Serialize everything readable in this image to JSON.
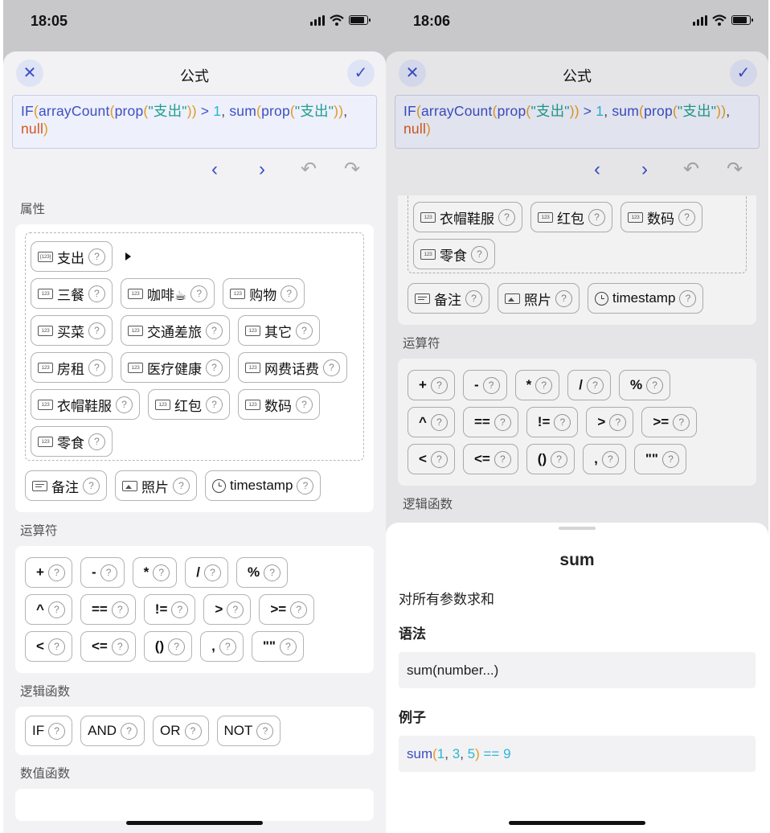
{
  "left": {
    "status_time": "18:05",
    "title": "公式",
    "formula": [
      {
        "t": "IF",
        "c": "k"
      },
      {
        "t": "(",
        "c": "p"
      },
      {
        "t": "arrayCount",
        "c": "k"
      },
      {
        "t": "(",
        "c": "p"
      },
      {
        "t": "prop",
        "c": "k"
      },
      {
        "t": "(",
        "c": "p"
      },
      {
        "t": "\"支出\"",
        "c": "s"
      },
      {
        "t": ")",
        "c": "p"
      },
      {
        "t": ")",
        "c": "p"
      },
      {
        "t": " > ",
        "c": "k"
      },
      {
        "t": "1",
        "c": "num"
      },
      {
        "t": ", ",
        "c": "g"
      },
      {
        "t": "sum",
        "c": "k"
      },
      {
        "t": "(",
        "c": "p"
      },
      {
        "t": "prop",
        "c": "k"
      },
      {
        "t": "(",
        "c": "p"
      },
      {
        "t": "\"支出\"",
        "c": "s"
      },
      {
        "t": ")",
        "c": "p"
      },
      {
        "t": ")",
        "c": "p"
      },
      {
        "t": ", ",
        "c": "g"
      },
      {
        "t": "null",
        "c": "n"
      },
      {
        "t": ")",
        "c": "p"
      }
    ],
    "sections": {
      "properties": "属性",
      "operators": "运算符",
      "logic": "逻辑函数",
      "numeric": "数值函数"
    },
    "property_group": {
      "parent": "支出",
      "children": [
        [
          "三餐",
          "咖啡☕",
          "购物"
        ],
        [
          "买菜",
          "交通差旅",
          "其它"
        ],
        [
          "房租",
          "医疗健康",
          "网费话费"
        ],
        [
          "衣帽鞋服",
          "红包",
          "数码"
        ],
        [
          "零食"
        ]
      ]
    },
    "other_props": [
      {
        "label": "备注",
        "icon": "note"
      },
      {
        "label": "照片",
        "icon": "photo"
      },
      {
        "label": "timestamp",
        "icon": "clock"
      }
    ],
    "operators": [
      [
        "+",
        "-",
        "*",
        "/",
        "%"
      ],
      [
        "^",
        "==",
        "!=",
        ">",
        ">="
      ],
      [
        "<",
        "<=",
        "()",
        ",",
        "\"\""
      ]
    ],
    "logic_funcs": [
      "IF",
      "AND",
      "OR",
      "NOT"
    ],
    "help_mark": "?",
    "number_icon": "123"
  },
  "right": {
    "status_time": "18:06",
    "title": "公式",
    "partial_props": [
      [
        "衣帽鞋服",
        "红包",
        "数码"
      ],
      [
        "零食"
      ]
    ],
    "other_props": [
      {
        "label": "备注",
        "icon": "note"
      },
      {
        "label": "照片",
        "icon": "photo"
      },
      {
        "label": "timestamp",
        "icon": "clock"
      }
    ],
    "sections": {
      "operators": "运算符",
      "logic": "逻辑函数"
    },
    "popup": {
      "title": "sum",
      "description": "对所有参数求和",
      "syntax_heading": "语法",
      "syntax": "sum(number...)",
      "example_heading": "例子",
      "example": [
        {
          "t": "sum",
          "c": "k"
        },
        {
          "t": "(",
          "c": "p"
        },
        {
          "t": "1",
          "c": "num"
        },
        {
          "t": ", ",
          "c": "g"
        },
        {
          "t": "3",
          "c": "num"
        },
        {
          "t": ", ",
          "c": "g"
        },
        {
          "t": "5",
          "c": "num"
        },
        {
          "t": ")",
          "c": "p"
        },
        {
          "t": " == ",
          "c": "eq"
        },
        {
          "t": "9",
          "c": "num"
        }
      ]
    }
  },
  "icons": {
    "close": "close-icon",
    "confirm": "check-icon",
    "prev": "chevron-left-icon",
    "next": "chevron-right-icon",
    "undo": "undo-icon",
    "redo": "redo-icon"
  },
  "colors": {
    "accent": "#3c4fc4",
    "paren": "#e29a22",
    "string": "#1f9e8e",
    "null": "#d4571f",
    "number": "#2ab7d6"
  }
}
